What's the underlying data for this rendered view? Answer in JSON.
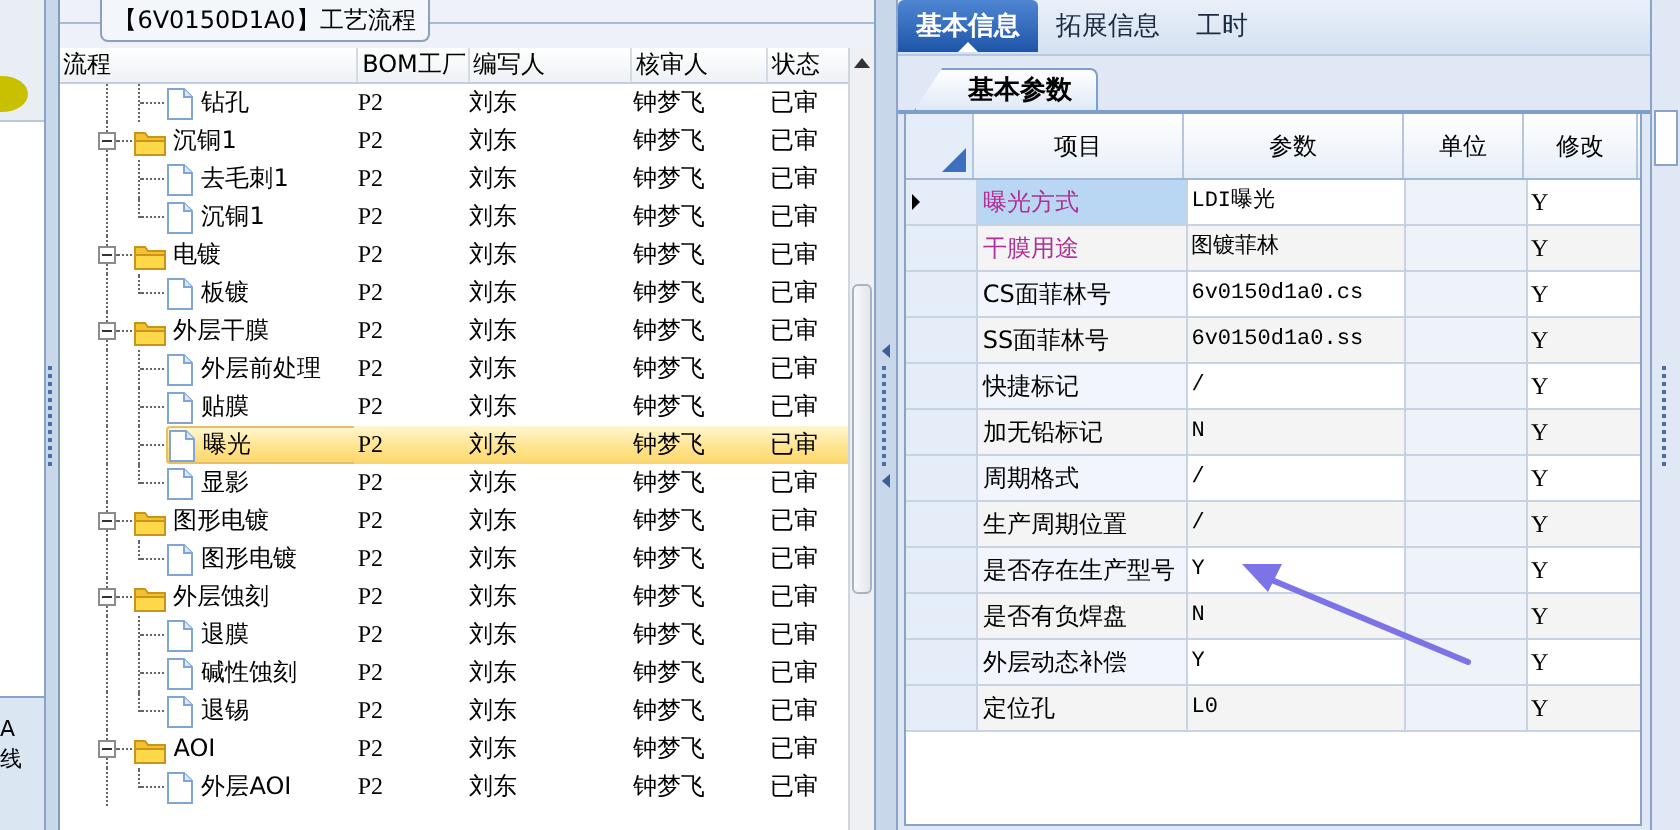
{
  "left_strip": {
    "tab_lines": [
      "A",
      "线"
    ]
  },
  "tree": {
    "title": "【6V0150D1A0】工艺流程",
    "columns": [
      "流程",
      "BOM工厂",
      "编写人",
      "核审人",
      "状态"
    ],
    "rows": [
      {
        "kind": "file",
        "label": "钻孔",
        "bom": "P2",
        "writer": "刘东",
        "reviewer": "钟梦飞",
        "status": "已审",
        "selected": false
      },
      {
        "kind": "folder",
        "label": "沉铜1",
        "bom": "P2",
        "writer": "刘东",
        "reviewer": "钟梦飞",
        "status": "已审",
        "selected": false,
        "expanded": true,
        "children": [
          {
            "kind": "file",
            "label": "去毛刺1",
            "bom": "P2",
            "writer": "刘东",
            "reviewer": "钟梦飞",
            "status": "已审",
            "selected": false
          },
          {
            "kind": "file",
            "label": "沉铜1",
            "bom": "P2",
            "writer": "刘东",
            "reviewer": "钟梦飞",
            "status": "已审",
            "selected": false
          }
        ]
      },
      {
        "kind": "folder",
        "label": "电镀",
        "bom": "P2",
        "writer": "刘东",
        "reviewer": "钟梦飞",
        "status": "已审",
        "selected": false,
        "expanded": true,
        "children": [
          {
            "kind": "file",
            "label": "板镀",
            "bom": "P2",
            "writer": "刘东",
            "reviewer": "钟梦飞",
            "status": "已审",
            "selected": false
          }
        ]
      },
      {
        "kind": "folder",
        "label": "外层干膜",
        "bom": "P2",
        "writer": "刘东",
        "reviewer": "钟梦飞",
        "status": "已审",
        "selected": false,
        "expanded": true,
        "children": [
          {
            "kind": "file",
            "label": "外层前处理",
            "bom": "P2",
            "writer": "刘东",
            "reviewer": "钟梦飞",
            "status": "已审",
            "selected": false
          },
          {
            "kind": "file",
            "label": "贴膜",
            "bom": "P2",
            "writer": "刘东",
            "reviewer": "钟梦飞",
            "status": "已审",
            "selected": false
          },
          {
            "kind": "file",
            "label": "曝光",
            "bom": "P2",
            "writer": "刘东",
            "reviewer": "钟梦飞",
            "status": "已审",
            "selected": true
          },
          {
            "kind": "file",
            "label": "显影",
            "bom": "P2",
            "writer": "刘东",
            "reviewer": "钟梦飞",
            "status": "已审",
            "selected": false
          }
        ]
      },
      {
        "kind": "folder",
        "label": "图形电镀",
        "bom": "P2",
        "writer": "刘东",
        "reviewer": "钟梦飞",
        "status": "已审",
        "selected": false,
        "expanded": true,
        "children": [
          {
            "kind": "file",
            "label": "图形电镀",
            "bom": "P2",
            "writer": "刘东",
            "reviewer": "钟梦飞",
            "status": "已审",
            "selected": false
          }
        ]
      },
      {
        "kind": "folder",
        "label": "外层蚀刻",
        "bom": "P2",
        "writer": "刘东",
        "reviewer": "钟梦飞",
        "status": "已审",
        "selected": false,
        "expanded": true,
        "children": [
          {
            "kind": "file",
            "label": "退膜",
            "bom": "P2",
            "writer": "刘东",
            "reviewer": "钟梦飞",
            "status": "已审",
            "selected": false
          },
          {
            "kind": "file",
            "label": "碱性蚀刻",
            "bom": "P2",
            "writer": "刘东",
            "reviewer": "钟梦飞",
            "status": "已审",
            "selected": false
          },
          {
            "kind": "file",
            "label": "退锡",
            "bom": "P2",
            "writer": "刘东",
            "reviewer": "钟梦飞",
            "status": "已审",
            "selected": false
          }
        ]
      },
      {
        "kind": "folder",
        "label": "AOI",
        "bom": "P2",
        "writer": "刘东",
        "reviewer": "钟梦飞",
        "status": "已审",
        "selected": false,
        "expanded": true,
        "children": [
          {
            "kind": "file",
            "label": "外层AOI",
            "bom": "P2",
            "writer": "刘东",
            "reviewer": "钟梦飞",
            "status": "已审",
            "selected": false
          }
        ]
      }
    ]
  },
  "tabs": [
    {
      "label": "基本信息",
      "selected": true
    },
    {
      "label": "拓展信息",
      "selected": false
    },
    {
      "label": "工时",
      "selected": false
    }
  ],
  "subtabs": [
    {
      "label": "基本参数",
      "selected": true
    }
  ],
  "params": {
    "columns": [
      "项目",
      "参数",
      "单位",
      "修改"
    ],
    "rows": [
      {
        "item": "曝光方式",
        "value": "LDI曝光",
        "modify": "Y",
        "color": "#b02f94",
        "current": true
      },
      {
        "item": "干膜用途",
        "value": "图镀菲林",
        "modify": "Y",
        "color": "#b02f94",
        "current": false
      },
      {
        "item": "CS面菲林号",
        "value": "6v0150d1a0.cs",
        "modify": "Y",
        "color": "#000000",
        "current": false
      },
      {
        "item": "SS面菲林号",
        "value": "6v0150d1a0.ss",
        "modify": "Y",
        "color": "#000000",
        "current": false
      },
      {
        "item": "快捷标记",
        "value": "/",
        "modify": "Y",
        "color": "#000000",
        "current": false
      },
      {
        "item": "加无铅标记",
        "value": "N",
        "modify": "Y",
        "color": "#000000",
        "current": false
      },
      {
        "item": "周期格式",
        "value": "/",
        "modify": "Y",
        "color": "#000000",
        "current": false
      },
      {
        "item": "生产周期位置",
        "value": "/",
        "modify": "Y",
        "color": "#000000",
        "current": false
      },
      {
        "item": "是否存在生产型号",
        "value": "Y",
        "modify": "Y",
        "color": "#000000",
        "current": false
      },
      {
        "item": "是否有负焊盘",
        "value": "N",
        "modify": "Y",
        "color": "#000000",
        "current": false
      },
      {
        "item": "外层动态补偿",
        "value": "Y",
        "modify": "Y",
        "color": "#000000",
        "current": false
      },
      {
        "item": "定位孔",
        "value": "L0",
        "modify": "Y",
        "color": "#000000",
        "current": false
      }
    ]
  }
}
